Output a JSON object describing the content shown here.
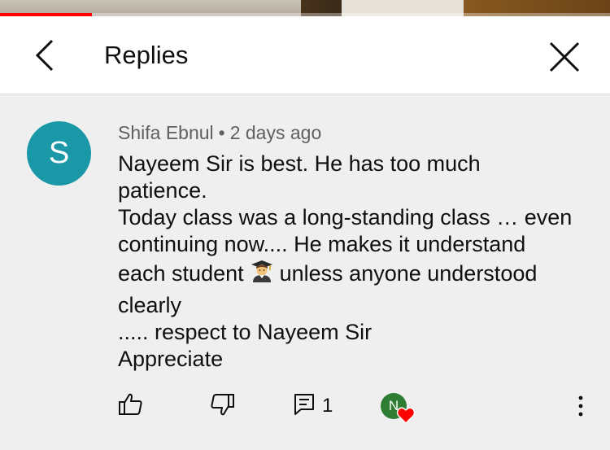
{
  "player": {
    "progress_fraction": 0.15,
    "progress_color": "#ff0000"
  },
  "header": {
    "title": "Replies",
    "back_icon": "chevron-left-icon",
    "close_icon": "close-icon"
  },
  "comment": {
    "avatar_letter": "S",
    "avatar_color": "#1a98a8",
    "author": "Shifa Ebnul",
    "separator": "•",
    "time": "2 days ago",
    "lines": [
      "Nayeem Sir is best.  He has too much",
      "patience.",
      "Today class was a long-standing class … even",
      "continuing now.... He makes it understand",
      "each student",
      "unless anyone understood",
      "clearly",
      "..... respect to Nayeem Sir",
      "Appreciate"
    ],
    "emoji": "student-emoji"
  },
  "actions": {
    "like_icon": "thumbs-up-icon",
    "dislike_icon": "thumbs-down-icon",
    "reply_icon": "reply-comment-icon",
    "reply_count": "1",
    "creator_heart_letter": "N",
    "creator_heart_color": "#2e7d32",
    "heart_color": "#ff0000",
    "more_icon": "more-vertical-icon"
  }
}
